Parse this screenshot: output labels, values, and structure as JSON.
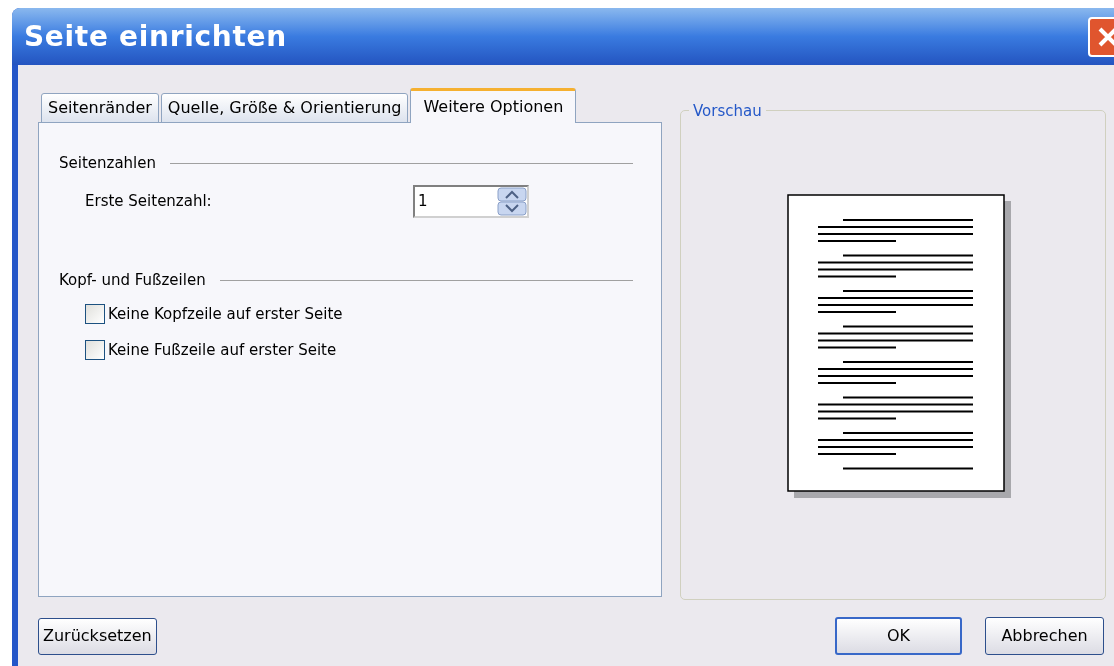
{
  "window": {
    "title": "Seite einrichten"
  },
  "tabs": [
    {
      "label": "Seitenränder",
      "selected": false
    },
    {
      "label": "Quelle, Größe & Orientierung",
      "selected": false
    },
    {
      "label": "Weitere Optionen",
      "selected": true
    }
  ],
  "sections": [
    {
      "heading": "Seitenzahlen",
      "fields": [
        {
          "kind": "spinner",
          "label": "Erste Seitenzahl:",
          "value": "1"
        }
      ]
    },
    {
      "heading": "Kopf- und Fußzeilen",
      "fields": [
        {
          "kind": "checkbox",
          "label": "Keine Kopfzeile auf erster Seite",
          "checked": false
        },
        {
          "kind": "checkbox",
          "label": "Keine Fußzeile auf erster Seite",
          "checked": false
        }
      ]
    }
  ],
  "preview": {
    "title": "Vorschau"
  },
  "buttons": {
    "reset": "Zurücksetzen",
    "ok": "OK",
    "cancel": "Abbrechen"
  }
}
